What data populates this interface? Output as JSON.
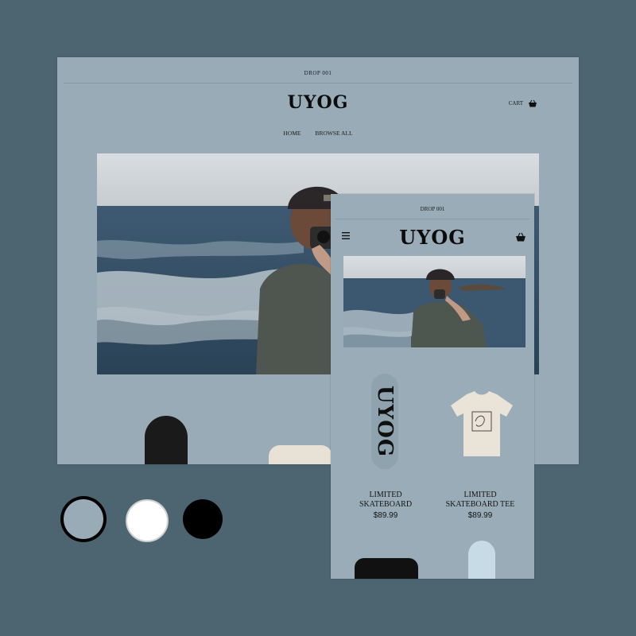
{
  "colors": {
    "background": "#4c6570",
    "brand_blue": "#98abb6",
    "white": "#ffffff",
    "black": "#000000"
  },
  "desktop": {
    "announcement": "DROP 001",
    "logo": "UYOG",
    "cart_label": "CART",
    "cart_icon": "basket-icon",
    "nav": [
      "HOME",
      "BROWSE ALL"
    ]
  },
  "mobile": {
    "announcement": "DROP 001",
    "menu_icon": "hamburger-icon",
    "logo": "UYOG",
    "cart_icon": "basket-icon",
    "board_text": "UYOG",
    "products": [
      {
        "name_line1": "LIMITED",
        "name_line2": "SKATEBOARD",
        "price": "$89.99"
      },
      {
        "name_line1": "LIMITED",
        "name_line2": "SKATEBOARD TEE",
        "price": "$89.99"
      }
    ]
  },
  "swatches": [
    "#98abb6",
    "#ffffff",
    "#000000"
  ]
}
